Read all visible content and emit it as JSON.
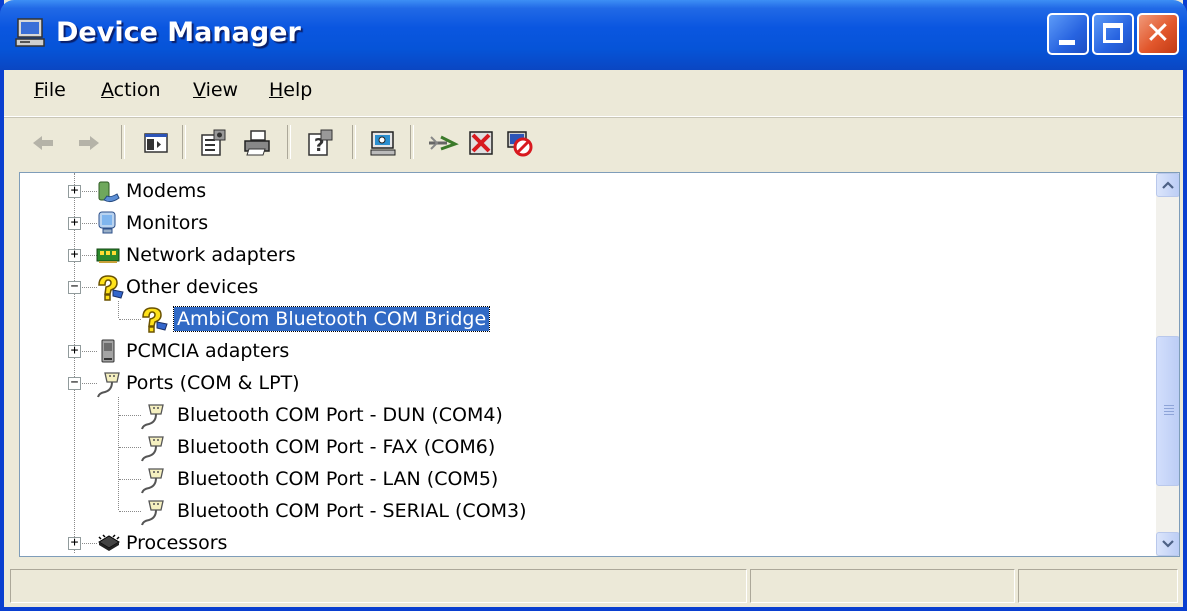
{
  "window": {
    "title": "Device Manager",
    "icon": "computer-icon",
    "controls": [
      "minimize",
      "maximize",
      "close"
    ]
  },
  "menu": [
    {
      "label": "File",
      "accel": "F",
      "rest": "ile"
    },
    {
      "label": "Action",
      "accel": "A",
      "rest": "ction"
    },
    {
      "label": "View",
      "accel": "V",
      "rest": "iew"
    },
    {
      "label": "Help",
      "accel": "H",
      "rest": "elp"
    }
  ],
  "toolbar": {
    "buttons": [
      "back-icon",
      "forward-icon",
      "show-hide-console-tree-icon",
      "properties-icon",
      "print-icon",
      "help-icon",
      "scan-hardware-changes-icon",
      "update-driver-icon",
      "uninstall-icon",
      "disable-icon"
    ]
  },
  "tree": {
    "rows": [
      {
        "label": "Modems",
        "icon": "modem-icon",
        "level": 0,
        "expander": "+"
      },
      {
        "label": "Monitors",
        "icon": "monitor-icon",
        "level": 0,
        "expander": "+"
      },
      {
        "label": "Network adapters",
        "icon": "network-adapter-icon",
        "level": 0,
        "expander": "+"
      },
      {
        "label": "Other devices",
        "icon": "unknown-device-icon",
        "level": 0,
        "expander": "-"
      },
      {
        "label": "AmbiCom Bluetooth COM Bridge",
        "icon": "unknown-device-icon",
        "level": 1,
        "selected": true
      },
      {
        "label": "PCMCIA adapters",
        "icon": "pcmcia-icon",
        "level": 0,
        "expander": "+"
      },
      {
        "label": "Ports (COM & LPT)",
        "icon": "port-icon",
        "level": 0,
        "expander": "-"
      },
      {
        "label": "Bluetooth COM Port - DUN (COM4)",
        "icon": "port-icon",
        "level": 1
      },
      {
        "label": "Bluetooth COM Port - FAX (COM6)",
        "icon": "port-icon",
        "level": 1
      },
      {
        "label": "Bluetooth COM Port - LAN (COM5)",
        "icon": "port-icon",
        "level": 1
      },
      {
        "label": "Bluetooth COM Port - SERIAL (COM3)",
        "icon": "port-icon",
        "level": 1
      },
      {
        "label": "Processors",
        "icon": "processor-icon",
        "level": 0,
        "expander": "+"
      }
    ]
  },
  "scrollbar": {
    "position": 0.6
  },
  "statusbar": {
    "panels": [
      "",
      "",
      ""
    ]
  },
  "colors": {
    "titlebar": "#0654d8",
    "selection": "#316ac5",
    "chrome": "#ece9d8"
  }
}
